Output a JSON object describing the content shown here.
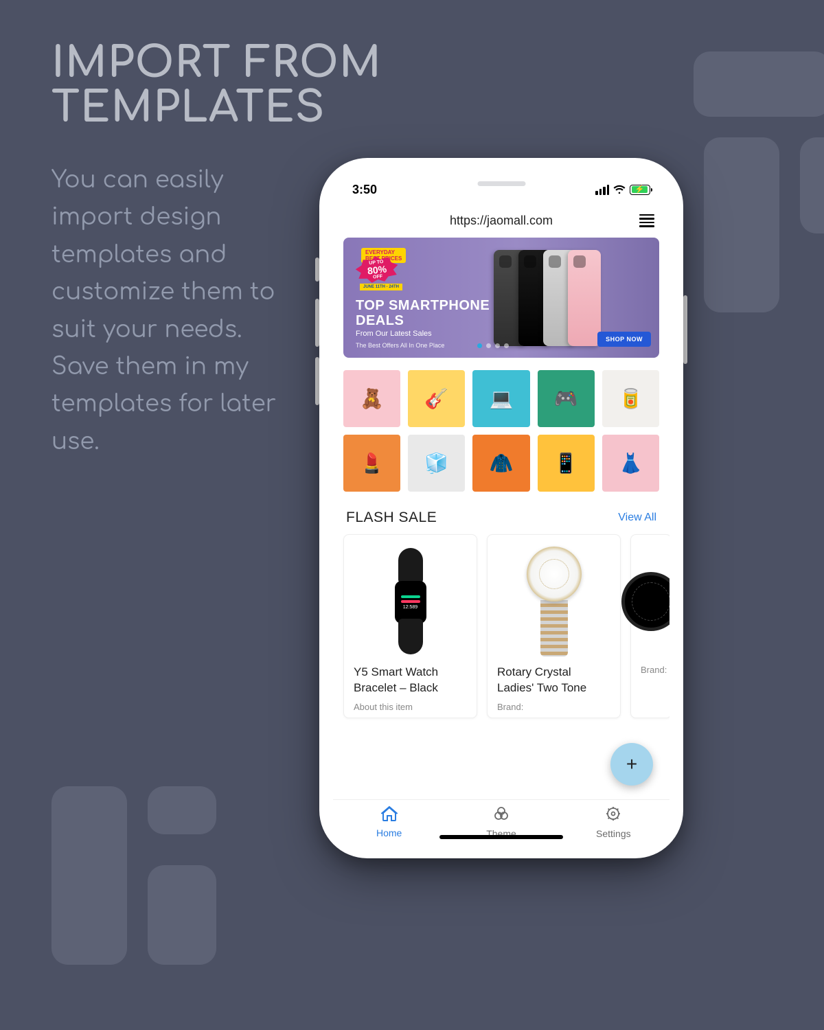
{
  "hero": {
    "title_l1": "IMPORT FROM",
    "title_l2": "TEMPLATES",
    "description": "You can easily import design templates and customize them to suit your needs. Save them in my templates for later use."
  },
  "status": {
    "time": "3:50"
  },
  "url": "https://jaomall.com",
  "banner": {
    "badge_top": "EVERYDAY",
    "badge_best": "BEST PRICES",
    "badge_upto": "UP TO",
    "badge_pct": "80%",
    "badge_off": "OFF",
    "badge_date": "JUNE 11TH - 24TH",
    "title_l1": "TOP SMARTPHONE",
    "title_l2": "DEALS",
    "subtitle": "From Our Latest Sales",
    "tagline": "The Best Offers All In One Place",
    "cta": "SHOP NOW"
  },
  "categories": [
    {
      "bg": "#f9c7cf",
      "emoji": "🧸"
    },
    {
      "bg": "#ffd766",
      "emoji": "🎸"
    },
    {
      "bg": "#3fbfd4",
      "emoji": "💻"
    },
    {
      "bg": "#2d9f7a",
      "emoji": "🎮"
    },
    {
      "bg": "#f2f0ed",
      "emoji": "🥫"
    },
    {
      "bg": "#f08a3c",
      "emoji": "💄"
    },
    {
      "bg": "#e9e9e9",
      "emoji": "🧊"
    },
    {
      "bg": "#f07b2c",
      "emoji": "🧥"
    },
    {
      "bg": "#ffc23c",
      "emoji": "📱"
    },
    {
      "bg": "#f6c3cc",
      "emoji": "👗"
    }
  ],
  "flash": {
    "title": "FLASH SALE",
    "view_all": "View All",
    "products": [
      {
        "name": "Y5 Smart Watch Bracelet – Black",
        "meta": "About this item"
      },
      {
        "name": "Rotary Crystal Ladies' Two Tone",
        "meta": "Brand:"
      },
      {
        "name": "",
        "meta": "Brand:"
      }
    ]
  },
  "fab": "+",
  "nav": {
    "items": [
      {
        "label": "Home",
        "active": true
      },
      {
        "label": "Theme",
        "active": false
      },
      {
        "label": "Settings",
        "active": false
      }
    ]
  }
}
